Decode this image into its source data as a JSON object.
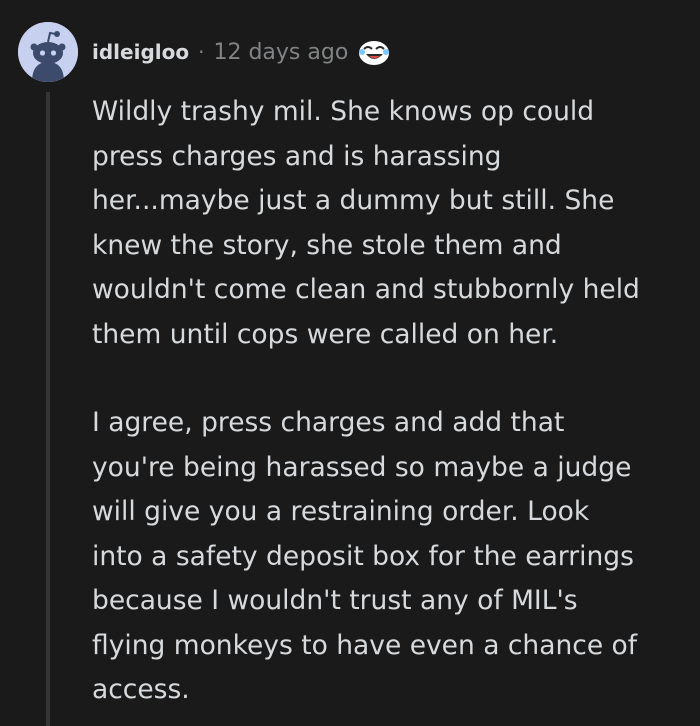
{
  "comment": {
    "author": "idleigloo",
    "separator": "·",
    "timestamp": "12 days ago",
    "avatar_icon": "snoo-avatar-icon",
    "award_icon": "laughing-face-award-icon",
    "paragraphs": [
      "Wildly trashy mil. She knows op could\npress charges and is harassing\nher...maybe just a dummy but still. She\nknew the story, she stole them and\nwouldn't come clean and stubbornly held\nthem until cops were called on her.",
      "I agree, press charges and add that\nyou're being harassed so maybe a judge\nwill give you a restraining order. Look\ninto a safety deposit box for the earrings\nbecause I wouldn't trust any of MIL's\nflying monkeys to have even a chance of\naccess."
    ]
  },
  "colors": {
    "background": "#1a1a1b",
    "text": "#d7dadc",
    "meta_text": "#818384",
    "avatar_bg": "#c7d0ef",
    "thread_line": "#343536"
  }
}
